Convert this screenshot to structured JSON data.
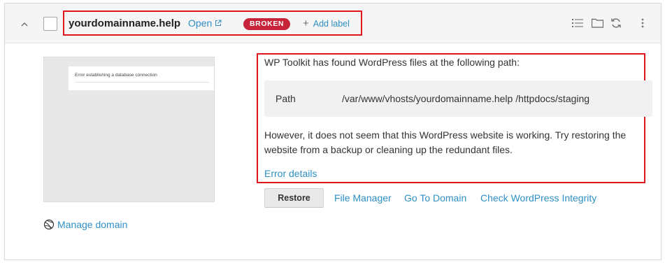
{
  "site": {
    "domain": "yourdomainname.help",
    "open_label": "Open",
    "status_badge": "BROKEN",
    "add_label": "Add label"
  },
  "header_icons": [
    "list-icon",
    "folder-icon",
    "refresh-icon",
    "more-vertical-icon"
  ],
  "preview": {
    "screenshot_text": "Error establishing a database connection"
  },
  "sidebar": {
    "manage_domain": "Manage domain"
  },
  "message": {
    "title": "WP Toolkit has found WordPress files at the following path:",
    "path_label": "Path",
    "path_value": "/var/www/vhosts/yourdomainname.help /httpdocs/staging",
    "body": "However, it does not seem that this WordPress website is working. Try restoring the website from a backup or cleaning up the redundant files.",
    "error_details": "Error details"
  },
  "actions": {
    "restore": "Restore",
    "file_manager": "File Manager",
    "go_to_domain": "Go To Domain",
    "check_integrity": "Check WordPress Integrity"
  },
  "colors": {
    "link": "#2f8fc4",
    "badge_bg": "#c7243a",
    "highlight_border": "#e0161c",
    "header_bg": "#f5f5f5",
    "path_bg": "#f1f1f1"
  }
}
